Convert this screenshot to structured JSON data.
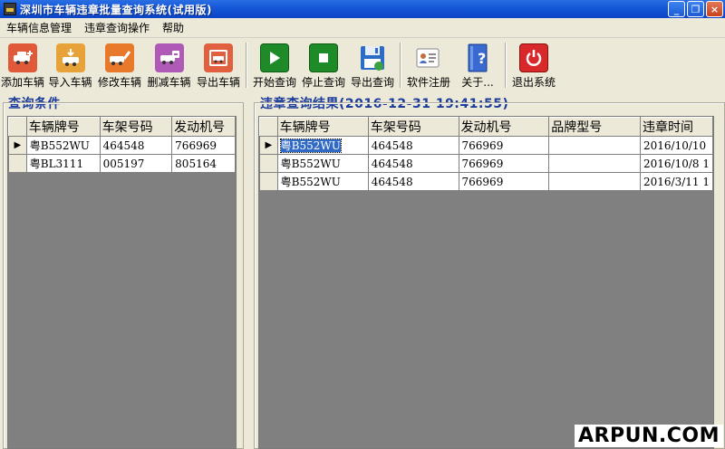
{
  "window": {
    "title": "深圳市车辆违章批量查询系统(试用版)",
    "min_label": "_",
    "max_label": "❐",
    "close_label": "×"
  },
  "menu": [
    "车辆信息管理",
    "违章查询操作",
    "帮助"
  ],
  "toolbar": {
    "group1": [
      {
        "label": "添加车辆",
        "icon": "add-car-icon"
      },
      {
        "label": "导入车辆",
        "icon": "import-car-icon"
      },
      {
        "label": "修改车辆",
        "icon": "edit-car-icon"
      },
      {
        "label": "删减车辆",
        "icon": "delete-car-icon"
      },
      {
        "label": "导出车辆",
        "icon": "export-car-icon"
      }
    ],
    "group2": [
      {
        "label": "开始查询",
        "icon": "play-icon"
      },
      {
        "label": "停止查询",
        "icon": "stop-icon"
      },
      {
        "label": "导出查询",
        "icon": "save-icon"
      }
    ],
    "group3": [
      {
        "label": "软件注册",
        "icon": "register-icon"
      },
      {
        "label": "关于...",
        "icon": "about-icon"
      }
    ],
    "group4": [
      {
        "label": "退出系统",
        "icon": "power-icon"
      }
    ]
  },
  "left": {
    "title": "查询条件",
    "columns": [
      "车辆牌号",
      "车架号码",
      "发动机号"
    ],
    "rows": [
      [
        "粤B552WU",
        "464548",
        "766969"
      ],
      [
        "粤BL3111",
        "005197",
        "805164"
      ]
    ],
    "current_row_marker": "▶"
  },
  "right": {
    "title": "违章查询结果(2016-12-31 19:41:55)",
    "columns": [
      "车辆牌号",
      "车架号码",
      "发动机号",
      "品牌型号",
      "违章时间"
    ],
    "rows": [
      [
        "粤B552WU",
        "464548",
        "766969",
        "",
        "2016/10/10"
      ],
      [
        "粤B552WU",
        "464548",
        "766969",
        "",
        "2016/10/8  1"
      ],
      [
        "粤B552WU",
        "464548",
        "766969",
        "",
        "2016/3/11  1"
      ]
    ],
    "current_row_marker": "▶"
  },
  "watermark": "ARPUN.COM"
}
